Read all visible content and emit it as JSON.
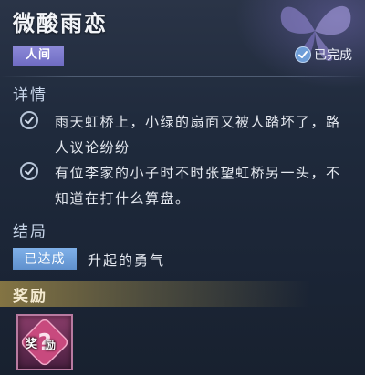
{
  "header": {
    "title": "微酸雨恋",
    "world_tag": "人间",
    "status": "已完成"
  },
  "details": {
    "section_title": "详情",
    "items": [
      {
        "text": "雨天虹桥上，小绿的扇面又被人踏坏了，路人议论纷纷"
      },
      {
        "text": "有位李家的小子时不时张望虹桥另一头，不知道在打什么算盘。"
      }
    ]
  },
  "ending": {
    "section_title": "结局",
    "tag": "已达成",
    "text": "升起的勇气"
  },
  "reward": {
    "section_title": "奖励",
    "item_label_1": "奖",
    "item_label_2": "励"
  },
  "colors": {
    "world_tag": "#7f7cd0",
    "result_tag": "#6f9fdc",
    "reward_bar": "#96824a",
    "reward_item": "#6a2e57"
  },
  "icons": {
    "status": "check-circle-icon",
    "detail": "check-circle-icon",
    "decoration": "butterfly-icon",
    "reward": "question-mark-icon"
  }
}
